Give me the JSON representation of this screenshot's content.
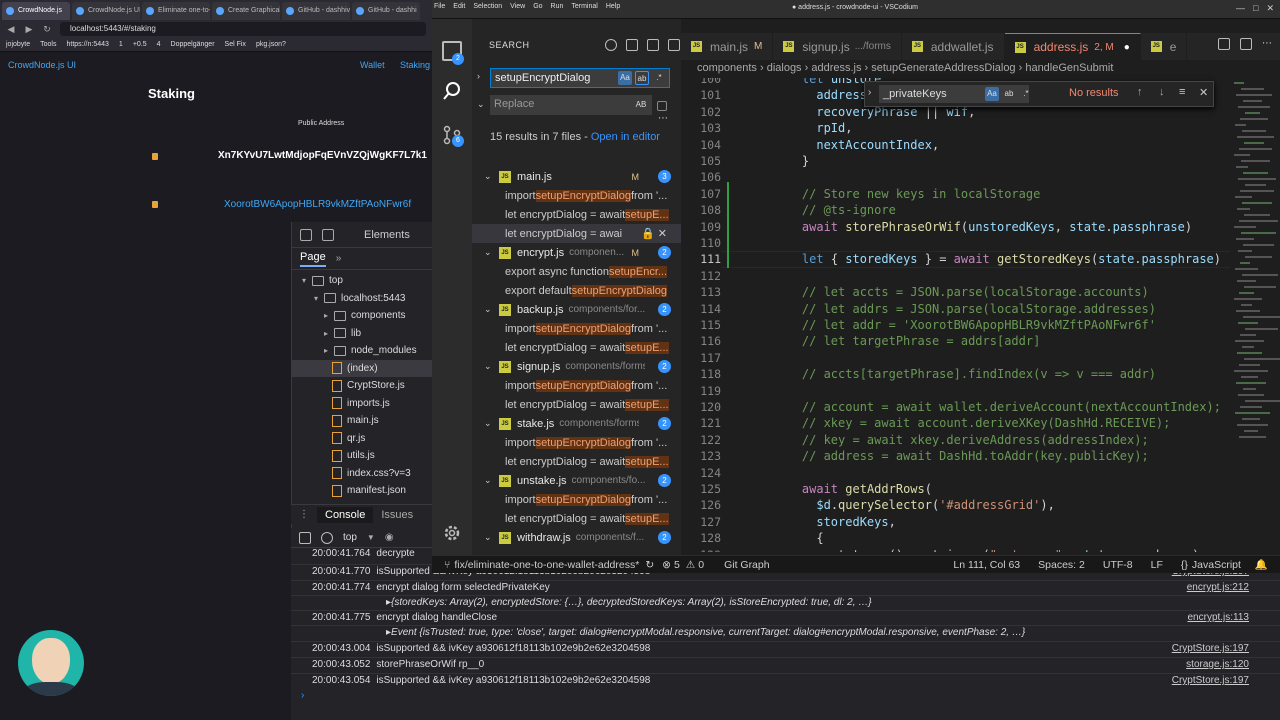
{
  "browser": {
    "tabs": [
      "CrowdNode.js",
      "CrowdNode.js UI",
      "Eliminate one-to-",
      "Create Graphical",
      "GitHub - dashhiv",
      "GitHub - dashhi"
    ],
    "url": "localhost:5443/#/staking",
    "bookmarks": [
      "jojobyte",
      "Tools",
      "https://n:5443",
      "1",
      "+0.5",
      "4",
      "Doppelgänger",
      "Sel Fix",
      "pkg.json?"
    ]
  },
  "site": {
    "logo": "CrowdNode.js UI",
    "nav": [
      "Wallet",
      "Staking"
    ],
    "title": "Staking",
    "public_address_label": "Public Address",
    "address1": "Xn7KYvU7LwtMdjopFqEVnVZQjWgKF7L7k1",
    "address2": "XoorotBW6ApopHBLR9vkMZftPAoNFwr6f"
  },
  "devtools": {
    "tabs": [
      "Elements"
    ],
    "subtab": "Page",
    "tree": [
      {
        "label": "top",
        "kind": "frame"
      },
      {
        "label": "localhost:5443",
        "kind": "cloud"
      },
      {
        "label": "components",
        "kind": "folder"
      },
      {
        "label": "lib",
        "kind": "folder"
      },
      {
        "label": "node_modules",
        "kind": "folder"
      },
      {
        "label": "(index)",
        "kind": "file"
      },
      {
        "label": "CryptStore.js",
        "kind": "file"
      },
      {
        "label": "imports.js",
        "kind": "file"
      },
      {
        "label": "main.js",
        "kind": "file"
      },
      {
        "label": "qr.js",
        "kind": "file"
      },
      {
        "label": "utils.js",
        "kind": "file"
      },
      {
        "label": "index.css?v=3",
        "kind": "file"
      },
      {
        "label": "manifest.json",
        "kind": "file"
      }
    ],
    "console_tabs": [
      "Console",
      "Issues"
    ],
    "context": "top",
    "logs": [
      {
        "time": "20:00:41.764",
        "msg": "decrypte",
        "src": ""
      },
      {
        "time": "20:00:41.770",
        "msg": "isSupported && ivKey a930612f18113b102e9b2e62e3204598",
        "src": "CryptStore.js:197"
      },
      {
        "time": "20:00:41.774",
        "msg": "encrypt dialog form selectedPrivateKey",
        "src": "encrypt.js:212"
      },
      {
        "time": "",
        "msg": "▸{storedKeys: Array(2), encryptedStore: {…}, decryptedStoredKeys: Array(2), isStoreEncrypted: true, dl: 2, …}",
        "src": ""
      },
      {
        "time": "20:00:41.775",
        "msg": "encrypt dialog handleClose",
        "src": "encrypt.js:113"
      },
      {
        "time": "",
        "msg": "▸Event {isTrusted: true, type: 'close', target: dialog#encryptModal.responsive, currentTarget: dialog#encryptModal.responsive, eventPhase: 2, …}",
        "src": ""
      },
      {
        "time": "20:00:43.004",
        "msg": "isSupported && ivKey a930612f18113b102e9b2e62e3204598",
        "src": "CryptStore.js:197"
      },
      {
        "time": "20:00:43.052",
        "msg": "storePhraseOrWif rp__0",
        "src": "storage.js:120"
      },
      {
        "time": "20:00:43.054",
        "msg": "isSupported && ivKey a930612f18113b102e9b2e62e3204598",
        "src": "CryptStore.js:197"
      }
    ],
    "prompt": "›"
  },
  "vscode": {
    "menu": [
      "File",
      "Edit",
      "Selection",
      "View",
      "Go",
      "Run",
      "Terminal",
      "Help"
    ],
    "title": "● address.js - crowdnode-ui - VSCodium",
    "activity_badges": [
      "2",
      "6"
    ],
    "search": {
      "header": "SEARCH",
      "query": "setupEncryptDialog",
      "replace_placeholder": "Replace",
      "summary": "15 results in 7 files - ",
      "open_in_editor": "Open in editor",
      "files": [
        {
          "name": "main.js",
          "dir": "",
          "mod": "M",
          "count": "3",
          "matches": [
            {
              "pre": "import ",
              "hl": "setupEncryptDialog",
              "post": " from '..."
            },
            {
              "pre": "let encryptDialog = await ",
              "hl": "setupE...",
              "post": ""
            },
            {
              "pre": "let encryptDialog = awai",
              "hl": "",
              "post": "",
              "selected": true
            }
          ]
        },
        {
          "name": "encrypt.js",
          "dir": "componen...",
          "mod": "M",
          "count": "2",
          "matches": [
            {
              "pre": "export async function ",
              "hl": "setupEncr...",
              "post": ""
            },
            {
              "pre": "export default ",
              "hl": "setupEncryptDialog",
              "post": ""
            }
          ]
        },
        {
          "name": "backup.js",
          "dir": "components/for...",
          "mod": "",
          "count": "2",
          "matches": [
            {
              "pre": "import ",
              "hl": "setupEncryptDialog",
              "post": " from '..."
            },
            {
              "pre": "let encryptDialog = await ",
              "hl": "setupE...",
              "post": ""
            }
          ]
        },
        {
          "name": "signup.js",
          "dir": "components/forms",
          "mod": "",
          "count": "2",
          "matches": [
            {
              "pre": "import ",
              "hl": "setupEncryptDialog",
              "post": " from '..."
            },
            {
              "pre": "let encryptDialog = await ",
              "hl": "setupE...",
              "post": ""
            }
          ]
        },
        {
          "name": "stake.js",
          "dir": "components/forms",
          "mod": "",
          "count": "2",
          "matches": [
            {
              "pre": "import ",
              "hl": "setupEncryptDialog",
              "post": " from '..."
            },
            {
              "pre": "let encryptDialog = await ",
              "hl": "setupE...",
              "post": ""
            }
          ]
        },
        {
          "name": "unstake.js",
          "dir": "components/fo...",
          "mod": "",
          "count": "2",
          "matches": [
            {
              "pre": "import ",
              "hl": "setupEncryptDialog",
              "post": " from '..."
            },
            {
              "pre": "let encryptDialog = await ",
              "hl": "setupE...",
              "post": ""
            }
          ]
        },
        {
          "name": "withdraw.js",
          "dir": "components/f...",
          "mod": "",
          "count": "2",
          "matches": []
        }
      ]
    },
    "tabs": [
      {
        "name": "main.js",
        "mod": "M",
        "active": false
      },
      {
        "name": "signup.js",
        "dir": ".../forms",
        "mod": "",
        "active": false
      },
      {
        "name": "addwallet.js",
        "mod": "",
        "active": false
      },
      {
        "name": "address.js",
        "mod": "2, M",
        "active": true
      },
      {
        "name": "e",
        "mod": "",
        "active": false
      }
    ],
    "breadcrumbs": "components  ›  dialogs  ›  address.js  ›  setupGenerateAddressDialog  ›  handleGenSubmit",
    "find_widget": {
      "query": "_privateKeys",
      "result": "No results"
    },
    "lines": [
      {
        "n": "100",
        "code": "    let unstore"
      },
      {
        "n": "101",
        "code": "      address,"
      },
      {
        "n": "102",
        "code": "      recoveryPhrase || wif,"
      },
      {
        "n": "103",
        "code": "      rpId,"
      },
      {
        "n": "104",
        "code": "      nextAccountIndex,"
      },
      {
        "n": "105",
        "code": "    }"
      },
      {
        "n": "106",
        "code": ""
      },
      {
        "n": "107",
        "code": "    // Store new keys in localStorage"
      },
      {
        "n": "108",
        "code": "    // @ts-ignore"
      },
      {
        "n": "109",
        "code": "    await storePhraseOrWif(unstoredKeys, state.passphrase)"
      },
      {
        "n": "110",
        "code": ""
      },
      {
        "n": "111",
        "code": "    let { storedKeys } = await getStoredKeys(state.passphrase)"
      },
      {
        "n": "112",
        "code": ""
      },
      {
        "n": "113",
        "code": "    // let accts = JSON.parse(localStorage.accounts)"
      },
      {
        "n": "114",
        "code": "    // let addrs = JSON.parse(localStorage.addresses)"
      },
      {
        "n": "115",
        "code": "    // let addr = 'XoorotBW6ApopHBLR9vkMZftPAoNFwr6f'"
      },
      {
        "n": "116",
        "code": "    // let targetPhrase = addrs[addr]"
      },
      {
        "n": "117",
        "code": ""
      },
      {
        "n": "118",
        "code": "    // accts[targetPhrase].findIndex(v => v === addr)"
      },
      {
        "n": "119",
        "code": ""
      },
      {
        "n": "120",
        "code": "    // account = await wallet.deriveAccount(nextAccountIndex);"
      },
      {
        "n": "121",
        "code": "    // xkey = await account.deriveXKey(DashHd.RECEIVE);"
      },
      {
        "n": "122",
        "code": "    // key = await xkey.deriveAddress(addressIndex);"
      },
      {
        "n": "123",
        "code": "    // address = await DashHd.toAddr(key.publicKey);"
      },
      {
        "n": "124",
        "code": ""
      },
      {
        "n": "125",
        "code": "    await getAddrRows("
      },
      {
        "n": "126",
        "code": "      $d.querySelector('#addressGrid'),"
      },
      {
        "n": "127",
        "code": "      storedKeys,"
      },
      {
        "n": "128",
        "code": "      {"
      },
      {
        "n": "129",
        "code": "        status: () => trigger(\"set:pass\", state.passphrase)"
      }
    ],
    "current_line": "111",
    "status": {
      "branch": "fix/eliminate-one-to-one-wallet-address*",
      "errors": "5",
      "warnings": "0",
      "git_graph": "Git Graph",
      "position": "Ln 111, Col 63",
      "spaces": "Spaces: 2",
      "encoding": "UTF-8",
      "eol": "LF",
      "language": "JavaScript"
    }
  }
}
